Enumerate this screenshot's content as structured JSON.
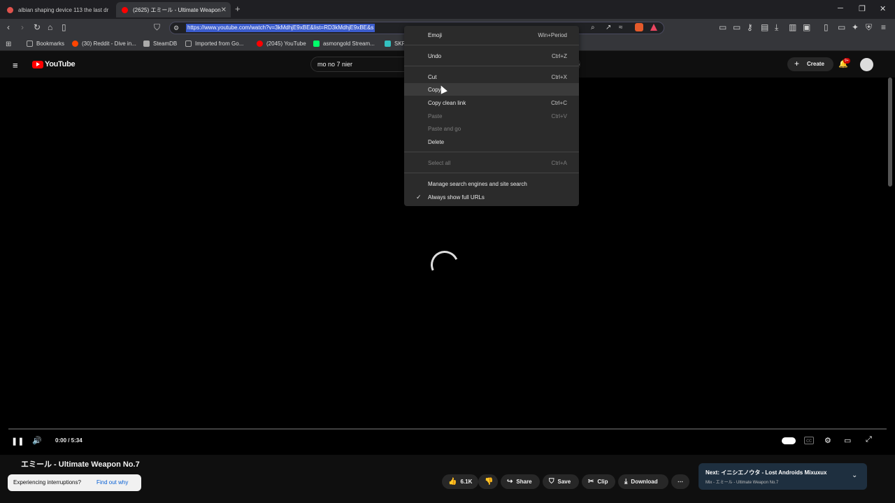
{
  "browser": {
    "tabs": [
      {
        "label": "albian shaping device 113 the last dr",
        "favicon_color": "#e0524c"
      },
      {
        "label": "(2625) エミール - Ultimate Weapon",
        "favicon_color": "#ff0000"
      }
    ],
    "new_tab": "+",
    "window": {
      "minimize": "─",
      "restore": "❐",
      "close": "✕"
    },
    "url": "https://www.youtube.com/watch?v=3kMdhjE9xBE&list=RD3kMdhjE9xBE&s",
    "bookmarks": [
      {
        "label": "Bookmarks",
        "color": "#888888"
      },
      {
        "label": "(30) Reddit - Dive in...",
        "color": "#ff4500"
      },
      {
        "label": "SteamDB",
        "color": "#aaaaaa"
      },
      {
        "label": "Imported from Go...",
        "color": "#888888"
      },
      {
        "label": "(2045) YouTube",
        "color": "#ff0000"
      },
      {
        "label": "asmongold Stream...",
        "color": "#00ff6a"
      },
      {
        "label": "SKP",
        "color": "#33c0c0"
      }
    ]
  },
  "youtube": {
    "logo": "YouTube",
    "search_value": "mo no 7 nier",
    "create_label": "Create",
    "notification_badge": "9+",
    "player": {
      "time": "0:00 / 5:34",
      "progress": 0
    },
    "video_title": "エミール - Ultimate Weapon No.7",
    "toast": {
      "text": "Experiencing interruptions?",
      "link": "Find out why"
    },
    "actions": {
      "likes": "6.1K",
      "share": "Share",
      "save": "Save",
      "clip": "Clip",
      "download": "Download"
    },
    "next": {
      "label": "Next: イニシエノウタ - Lost Androids Mixuxux",
      "sub": "Mix - エミール - Ultimate Weapon No.7"
    }
  },
  "context_menu": {
    "items": [
      {
        "label": "Emoji",
        "shortcut": "Win+Period"
      },
      {
        "label": "Undo",
        "shortcut": "Ctrl+Z"
      },
      {
        "label": "Cut",
        "shortcut": "Ctrl+X"
      },
      {
        "label": "Copy",
        "shortcut": ""
      },
      {
        "label": "Copy clean link",
        "shortcut": "Ctrl+C"
      },
      {
        "label": "Paste",
        "shortcut": "Ctrl+V"
      },
      {
        "label": "Paste and go",
        "shortcut": ""
      },
      {
        "label": "Delete",
        "shortcut": ""
      },
      {
        "label": "Select all",
        "shortcut": "Ctrl+A"
      },
      {
        "label": "Manage search engines and site search",
        "shortcut": ""
      },
      {
        "label": "Always show full URLs",
        "shortcut": "",
        "checked": "✓"
      }
    ]
  }
}
